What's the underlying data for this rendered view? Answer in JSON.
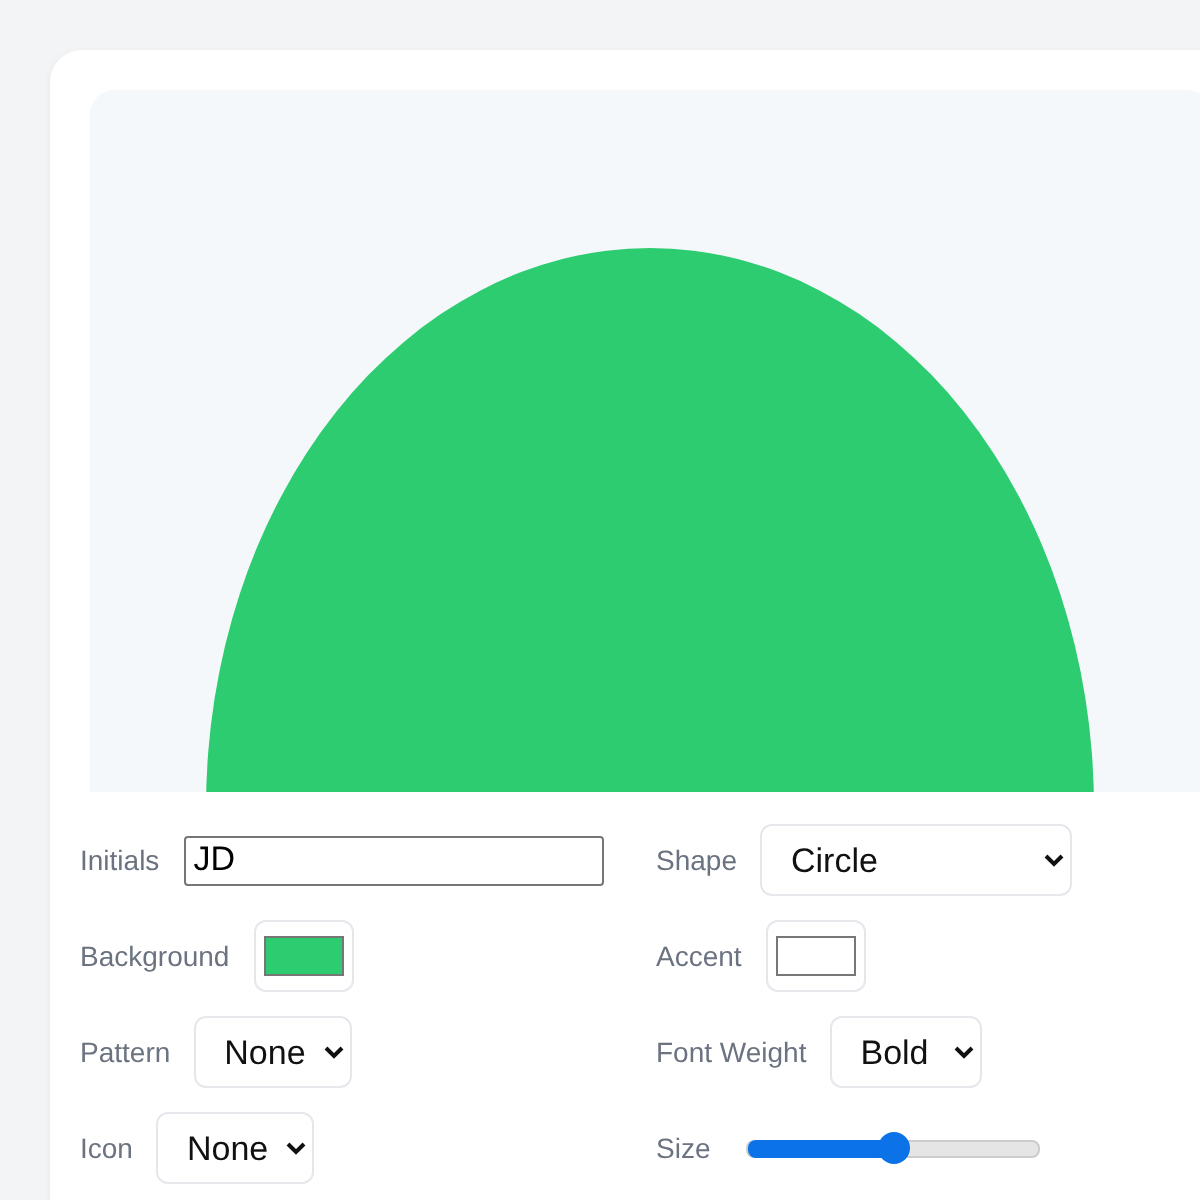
{
  "fields": [
    {
      "kind": "text",
      "label": "Initials",
      "value": "JD"
    },
    {
      "kind": "select",
      "label": "Shape",
      "value": "Circle"
    },
    {
      "kind": "color",
      "label": "Background",
      "color": "#2ecc71"
    },
    {
      "kind": "color",
      "label": "Accent",
      "color": "#ffffff"
    },
    {
      "kind": "select",
      "label": "Pattern",
      "value": "None"
    },
    {
      "kind": "select",
      "label": "Font Weight",
      "value": "Bold"
    },
    {
      "kind": "select",
      "label": "Icon",
      "value": "None"
    },
    {
      "kind": "range",
      "label": "Size",
      "level": 0.5
    }
  ]
}
